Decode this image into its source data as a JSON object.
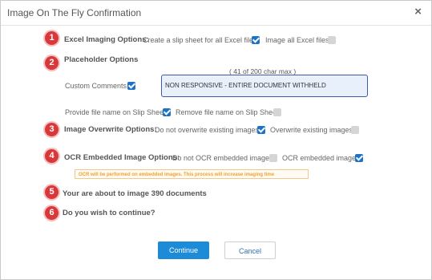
{
  "dialog": {
    "title": "Image On The Fly Confirmation",
    "close_glyph": "×"
  },
  "steps": [
    "1",
    "2",
    "3",
    "4",
    "5",
    "6"
  ],
  "excel": {
    "label": "Excel Imaging Options:",
    "option1": "Create a slip sheet for all Excel files",
    "option1_checked": true,
    "option2": "Image all Excel files",
    "option2_checked": false
  },
  "placeholder": {
    "label": "Placeholder Options",
    "char_count": "( 41 of 200 char max )",
    "custom_comments_label": "Custom Comments",
    "custom_comments_checked": true,
    "comment_value": "NON RESPONSIVE - ENTIRE DOCUMENT WITHHELD",
    "filename_label": "Provide file name on Slip Sheet",
    "filename_checked": true,
    "remove_label": "Remove file name on Slip Sheet",
    "remove_checked": false
  },
  "overwrite": {
    "label": "Image Overwrite Options:",
    "option1": "Do not overwrite existing images",
    "option1_checked": true,
    "option2": "Overwrite existing images",
    "option2_checked": false
  },
  "ocr": {
    "label": "OCR Embedded Image Options:",
    "option1": "Do not OCR embedded images",
    "option1_checked": false,
    "option2": "OCR embedded images",
    "option2_checked": true,
    "warning": "OCR will be performed on embedded images. This process will increase imaging time"
  },
  "summary": {
    "about": "Your are about to image 390 documents",
    "confirm": "Do you wish to continue?"
  },
  "buttons": {
    "continue": "Continue",
    "cancel": "Cancel"
  },
  "colors": {
    "accent": "#1e8bd8",
    "step_badge": "#d9383a",
    "checkbox_on": "#1a73c9",
    "warning_text": "#f2a12c"
  }
}
